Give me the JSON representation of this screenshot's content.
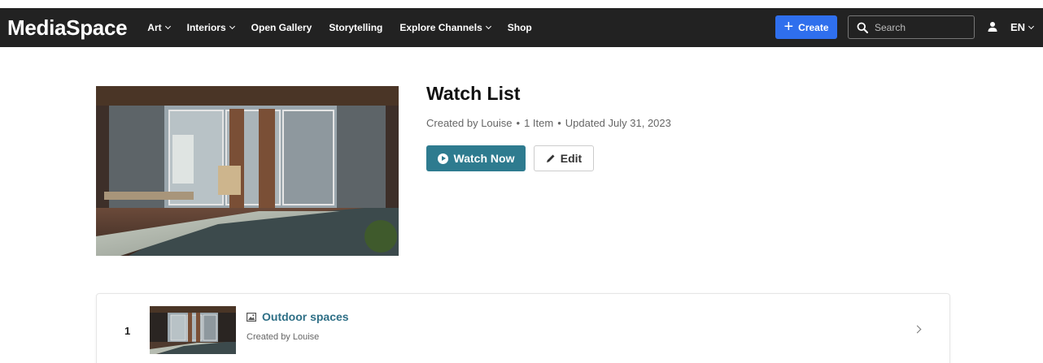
{
  "header": {
    "brand": "MediaSpace",
    "nav": [
      {
        "label": "Art",
        "has_dropdown": true
      },
      {
        "label": "Interiors",
        "has_dropdown": true
      },
      {
        "label": "Open Gallery",
        "has_dropdown": false
      },
      {
        "label": "Storytelling",
        "has_dropdown": false
      },
      {
        "label": "Explore Channels",
        "has_dropdown": true
      },
      {
        "label": "Shop",
        "has_dropdown": false
      }
    ],
    "create_label": "Create",
    "search_placeholder": "Search",
    "language": "EN",
    "colors": {
      "bar": "#222222",
      "create": "#2f6fed"
    }
  },
  "playlist": {
    "title": "Watch List",
    "created_by": "Created by Louise",
    "item_count": "1 Item",
    "updated": "Updated July 31, 2023",
    "watch_now_label": "Watch Now",
    "edit_label": "Edit",
    "colors": {
      "accent": "#2e7b8f"
    }
  },
  "entries": [
    {
      "index": "1",
      "title": "Outdoor spaces",
      "subtitle": "Created by Louise",
      "type_icon": "image-icon"
    }
  ]
}
